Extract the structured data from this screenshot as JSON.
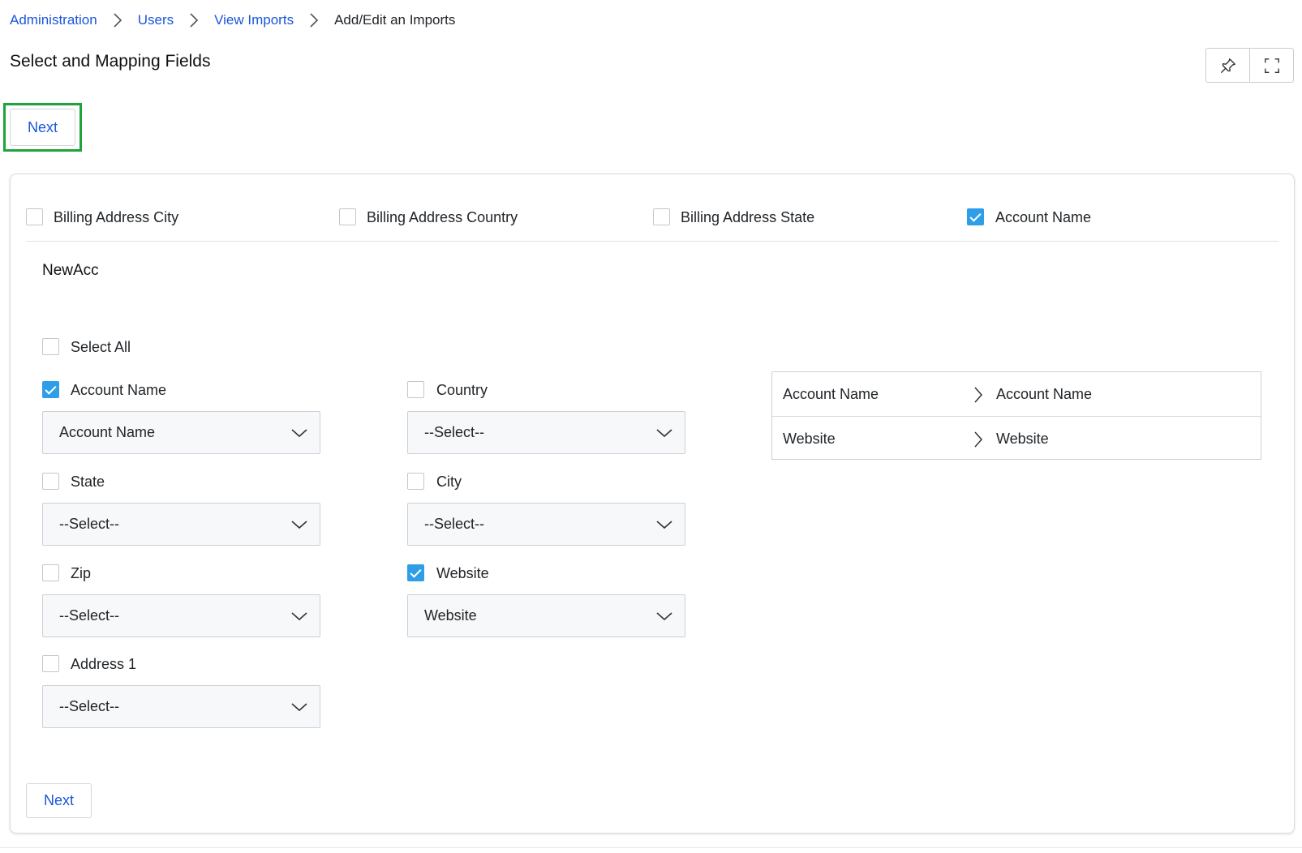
{
  "breadcrumb": {
    "items": [
      "Administration",
      "Users",
      "View Imports"
    ],
    "current": "Add/Edit an Imports"
  },
  "page": {
    "title": "Select and Mapping Fields"
  },
  "toolbar": {
    "pin_icon": "pin-icon",
    "expand_icon": "expand-icon"
  },
  "actions": {
    "next_label": "Next"
  },
  "columns_filter": [
    {
      "label": "Billing Address City",
      "checked": false
    },
    {
      "label": "Billing Address Country",
      "checked": false
    },
    {
      "label": "Billing Address State",
      "checked": false
    },
    {
      "label": "Account Name",
      "checked": true
    }
  ],
  "section": {
    "title": "NewAcc",
    "select_all_label": "Select All"
  },
  "fields": [
    {
      "label": "Account Name",
      "checked": true,
      "selected": "Account Name"
    },
    {
      "label": "Country",
      "checked": false,
      "selected": "--Select--"
    },
    {
      "label": "State",
      "checked": false,
      "selected": "--Select--"
    },
    {
      "label": "City",
      "checked": false,
      "selected": "--Select--"
    },
    {
      "label": "Zip",
      "checked": false,
      "selected": "--Select--"
    },
    {
      "label": "Website",
      "checked": true,
      "selected": "Website"
    },
    {
      "label": "Address 1",
      "checked": false,
      "selected": "--Select--"
    }
  ],
  "mapping": [
    {
      "source": "Account Name",
      "target": "Account Name"
    },
    {
      "source": "Website",
      "target": "Website"
    }
  ],
  "colors": {
    "link": "#1a56db",
    "checkbox_checked": "#2f9ee8",
    "highlight": "#1fa33b"
  }
}
